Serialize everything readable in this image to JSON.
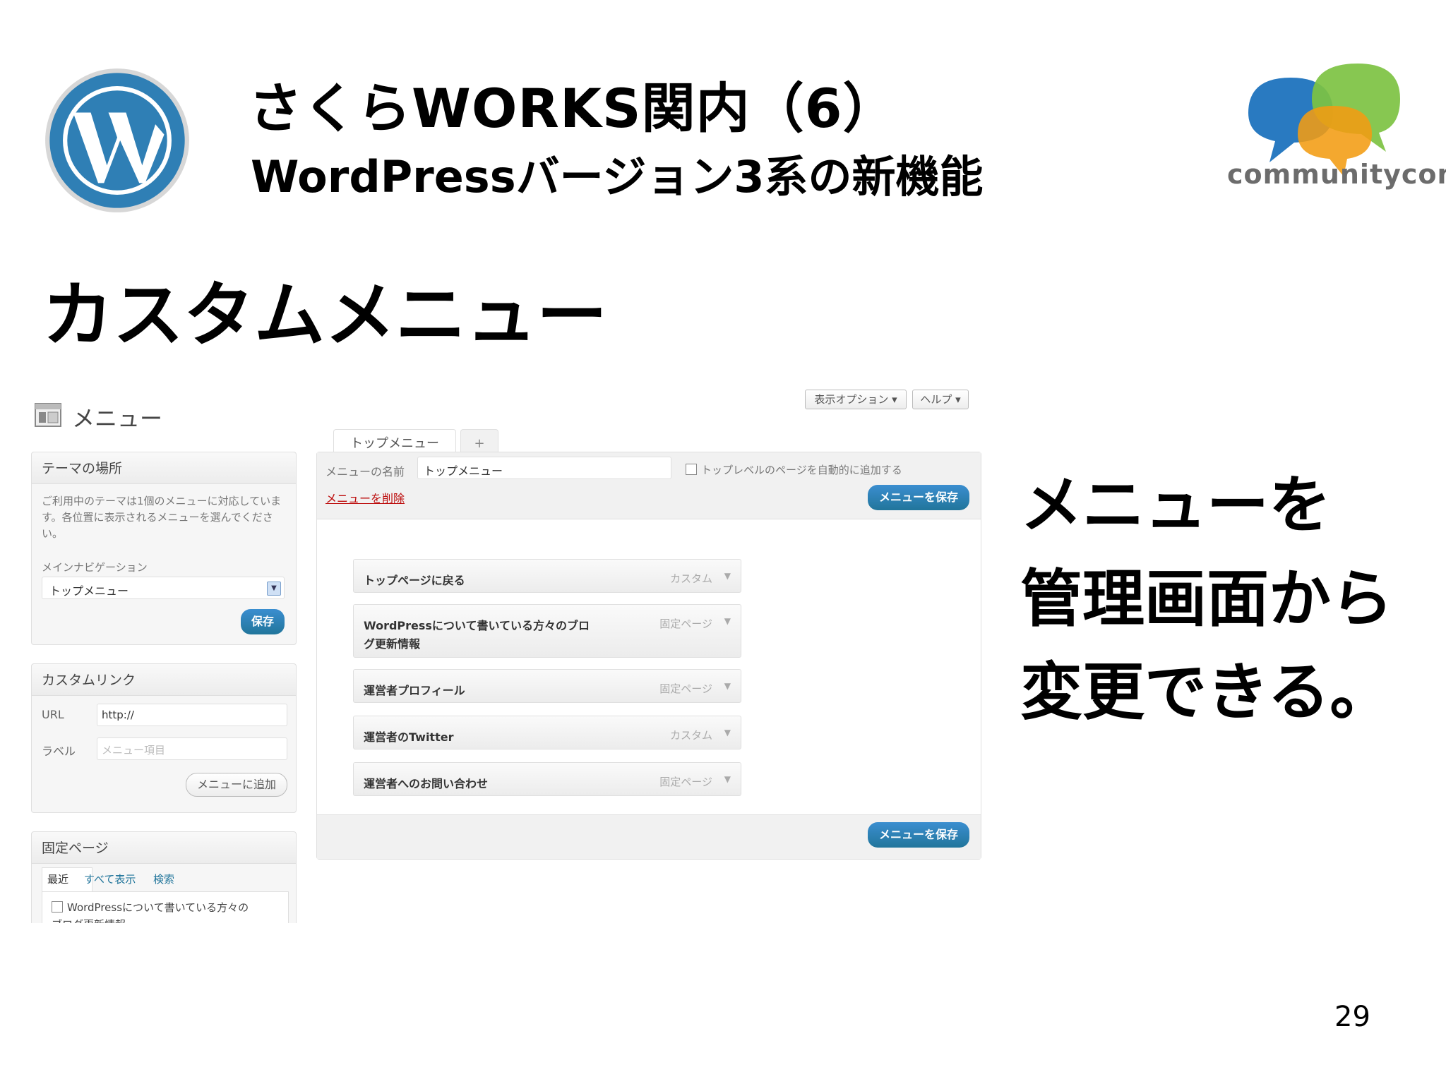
{
  "header": {
    "title": "さくらWORKS関内（6）",
    "subtitle": "WordPressバージョン3系の新機能",
    "partner_logo_text": "communitycom"
  },
  "heading": "カスタムメニュー",
  "side_text": [
    "メニューを",
    "管理画面から",
    "変更できる。"
  ],
  "page_number": "29",
  "screenshot": {
    "page_title": "メニュー",
    "top_buttons": [
      "表示オプション ▾",
      "ヘルプ ▾"
    ],
    "tabs": [
      "トップメニュー",
      "+"
    ],
    "theme_locations": {
      "title": "テーマの場所",
      "description": "ご利用中のテーマは1個のメニューに対応しています。各位置に表示されるメニューを選んでください。",
      "label": "メインナビゲーション",
      "selected": "トップメニュー",
      "save_label": "保存"
    },
    "custom_links": {
      "title": "カスタムリンク",
      "url_label": "URL",
      "url_value": "http://",
      "label_label": "ラベル",
      "label_placeholder": "メニュー項目",
      "add_label": "メニューに追加"
    },
    "pages": {
      "title": "固定ページ",
      "tabs": [
        "最近",
        "すべて表示",
        "検索"
      ],
      "first_item": "WordPressについて書いている方々の",
      "first_item_cont": "ブログ更新情報"
    },
    "editor": {
      "name_label": "メニューの名前",
      "name_value": "トップメニュー",
      "auto_add_label": "トップレベルのページを自動的に追加する",
      "delete_label": "メニューを削除",
      "save_label": "メニューを保存",
      "items": [
        {
          "title": "トップページに戻る",
          "type": "カスタム"
        },
        {
          "title": "WordPressについて書いている方々のブロ",
          "title2": "グ更新情報",
          "type": "固定ページ"
        },
        {
          "title": "運営者プロフィール",
          "type": "固定ページ"
        },
        {
          "title": "運営者のTwitter",
          "type": "カスタム"
        },
        {
          "title": "運営者へのお問い合わせ",
          "type": "固定ページ"
        }
      ]
    }
  },
  "colors": {
    "wp_blue": "#21759b",
    "bubble_blue": "#1e73be",
    "bubble_green": "#7dc242",
    "bubble_orange": "#f39c12"
  }
}
